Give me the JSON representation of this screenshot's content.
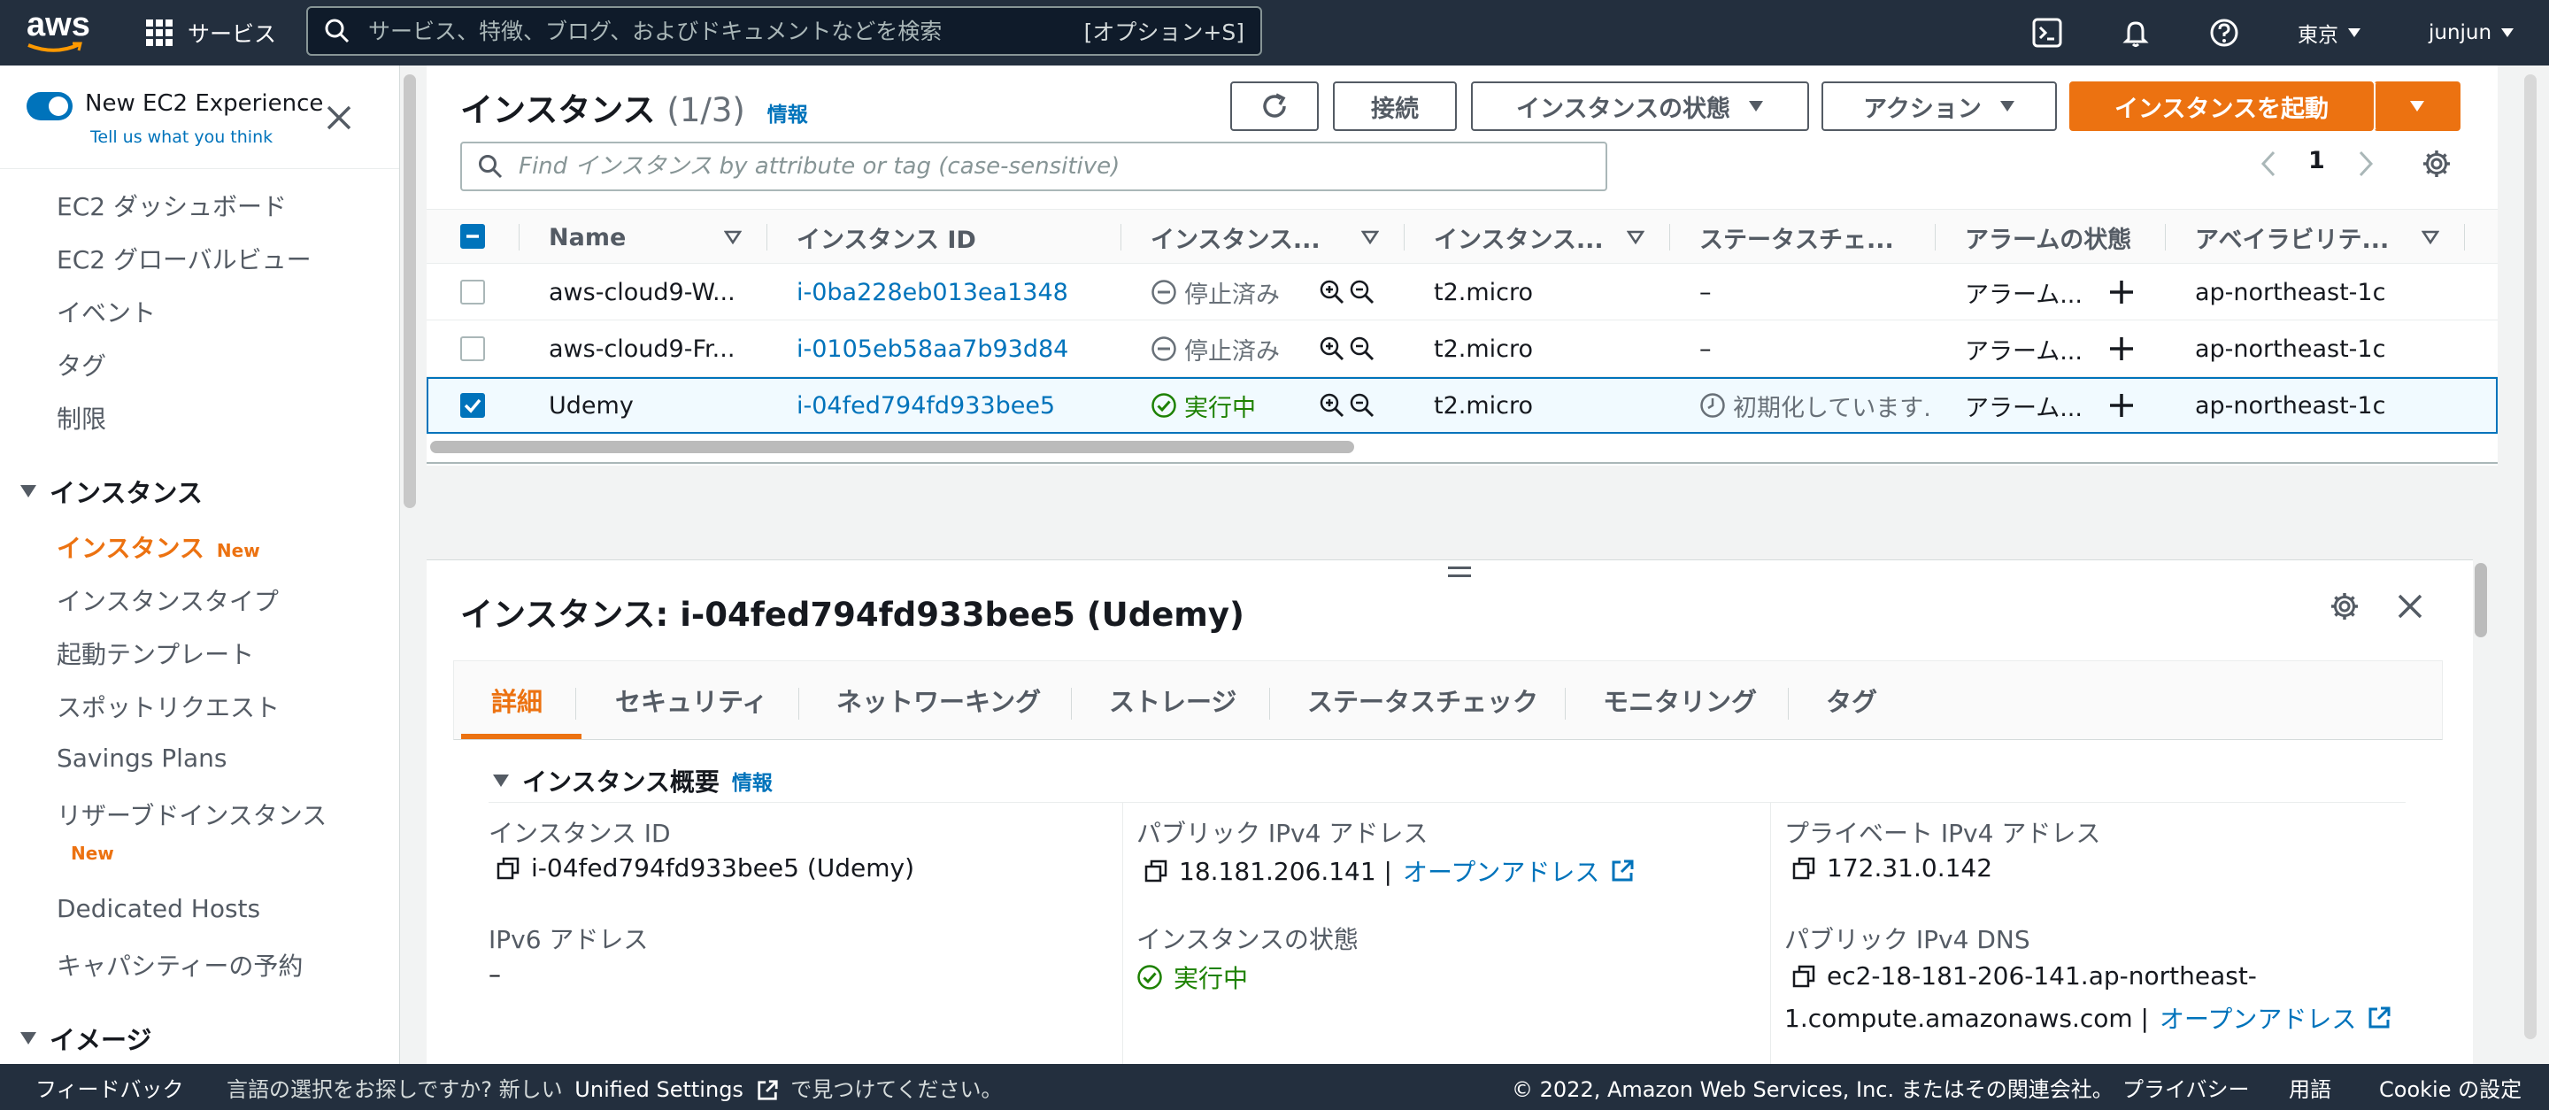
{
  "topnav": {
    "logo_text": "aws",
    "services_label": "サービス",
    "search_placeholder": "サービス、特徴、ブログ、およびドキュメントなどを検索",
    "search_shortcut": "[オプション+S]",
    "region": "東京",
    "user": "junjun"
  },
  "sidebar": {
    "new_experience_label": "New EC2 Experience",
    "tell_us": "Tell us what you think",
    "items_top": [
      "EC2 ダッシュボード",
      "EC2 グローバルビュー",
      "イベント",
      "タグ",
      "制限"
    ],
    "section_instances": "インスタンス",
    "instances_items": [
      "インスタンス",
      "インスタンスタイプ",
      "起動テンプレート",
      "スポットリクエスト",
      "Savings Plans",
      "リザーブドインスタンス",
      "Dedicated Hosts",
      "キャパシティーの予約"
    ],
    "new_badge": "New",
    "section_images": "イメージ"
  },
  "main": {
    "title": "インスタンス",
    "count": "(1/3)",
    "info_label": "情報",
    "connect_label": "接続",
    "instance_state_label": "インスタンスの状態",
    "actions_label": "アクション",
    "launch_label": "インスタンスを起動",
    "filter_placeholder": "Find インスタンス by attribute or tag (case-sensitive)",
    "page_number": "1"
  },
  "table": {
    "headers": [
      "Name",
      "インスタンス ID",
      "インスタンス...",
      "インスタンス...",
      "ステータスチェ...",
      "アラームの状態",
      "アベイラビリテ..."
    ],
    "rows": [
      {
        "name": "aws-cloud9-W...",
        "id": "i-0ba228eb013ea1348",
        "state": "停止済み",
        "type": "t2.micro",
        "status": "–",
        "alarm": "アラーム...",
        "az": "ap-northeast-1c",
        "selected": false
      },
      {
        "name": "aws-cloud9-Fr...",
        "id": "i-0105eb58aa7b93d84",
        "state": "停止済み",
        "type": "t2.micro",
        "status": "–",
        "alarm": "アラーム...",
        "az": "ap-northeast-1c",
        "selected": false
      },
      {
        "name": "Udemy",
        "id": "i-04fed794fd933bee5",
        "state": "実行中",
        "type": "t2.micro",
        "status": "初期化しています.",
        "alarm": "アラーム...",
        "az": "ap-northeast-1c",
        "selected": true
      }
    ]
  },
  "detail": {
    "title": "インスタンス: i-04fed794fd933bee5 (Udemy)",
    "tabs": [
      "詳細",
      "セキュリティ",
      "ネットワーキング",
      "ストレージ",
      "ステータスチェック",
      "モニタリング",
      "タグ"
    ],
    "summary_header": "インスタンス概要",
    "info_label": "情報",
    "instance_id_label": "インスタンス ID",
    "instance_id_value": "i-04fed794fd933bee5 (Udemy)",
    "ipv6_label": "IPv6 アドレス",
    "ipv6_value": "–",
    "public_ipv4_label": "パブリック IPv4 アドレス",
    "public_ipv4_value": "18.181.206.141 |",
    "open_address_label": "オープンアドレス",
    "state_label": "インスタンスの状態",
    "state_value": "実行中",
    "private_ipv4_label": "プライベート IPv4 アドレス",
    "private_ipv4_value": "172.31.0.142",
    "public_dns_label": "パブリック IPv4 DNS",
    "public_dns_line1": "ec2-18-181-206-141.ap-northeast-",
    "public_dns_line2": "1.compute.amazonaws.com |"
  },
  "footer": {
    "feedback": "フィードバック",
    "lang_text_before": "言語の選択をお探しですか? 新しい",
    "unified_settings": "Unified Settings",
    "lang_text_after": "で見つけてください。",
    "copyright": "© 2022, Amazon Web Services, Inc. またはその関連会社。",
    "privacy": "プライバシー",
    "terms": "用語",
    "cookie": "Cookie の設定"
  },
  "colors": {
    "nav_bg": "#232f3e",
    "accent": "#ec7211",
    "link": "#0073bb",
    "running": "#1d8102"
  }
}
